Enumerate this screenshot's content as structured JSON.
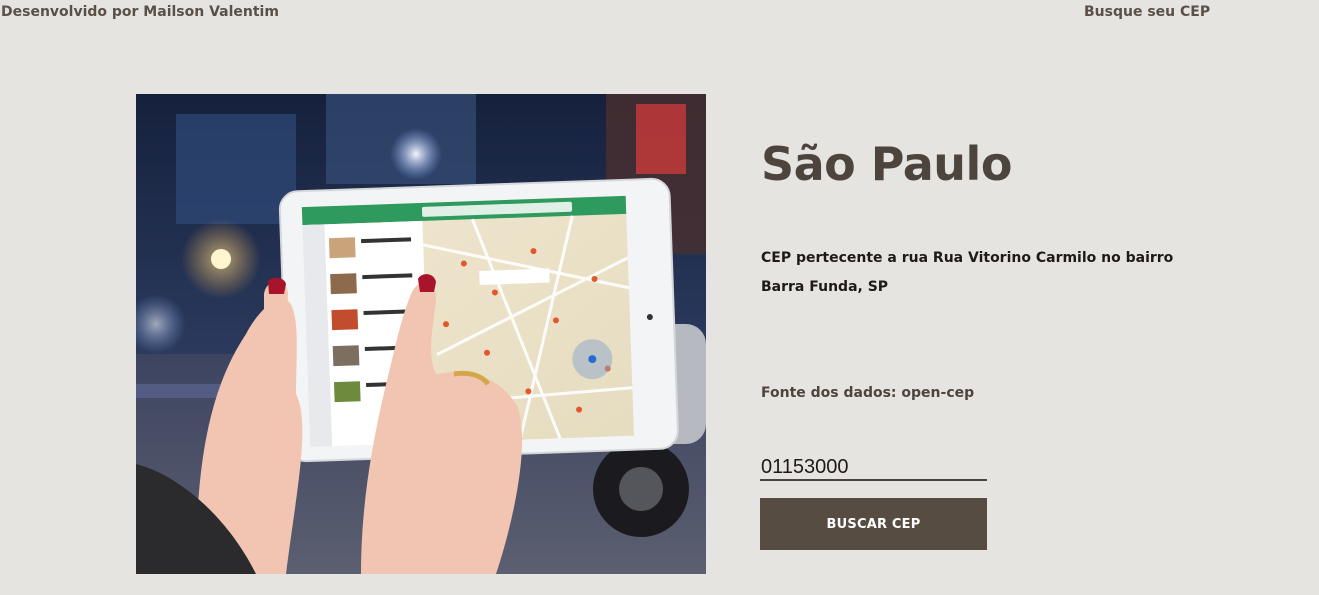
{
  "header": {
    "credit": "Desenvolvido por Mailson Valentim",
    "nav_link": "Busque seu CEP"
  },
  "hero": {
    "image_description_icon": "tablet-map-photo"
  },
  "result": {
    "city": "São Paulo",
    "description": "CEP pertecente a rua Rua Vitorino Carmilo no bairro Barra Funda, SP",
    "source_label": "Fonte dos dados: open-cep"
  },
  "search": {
    "cep_value": "01153000",
    "button_label": "BUSCAR CEP"
  },
  "colors": {
    "background": "#e6e4e1",
    "accent": "#574c42",
    "title": "#4d453d"
  }
}
